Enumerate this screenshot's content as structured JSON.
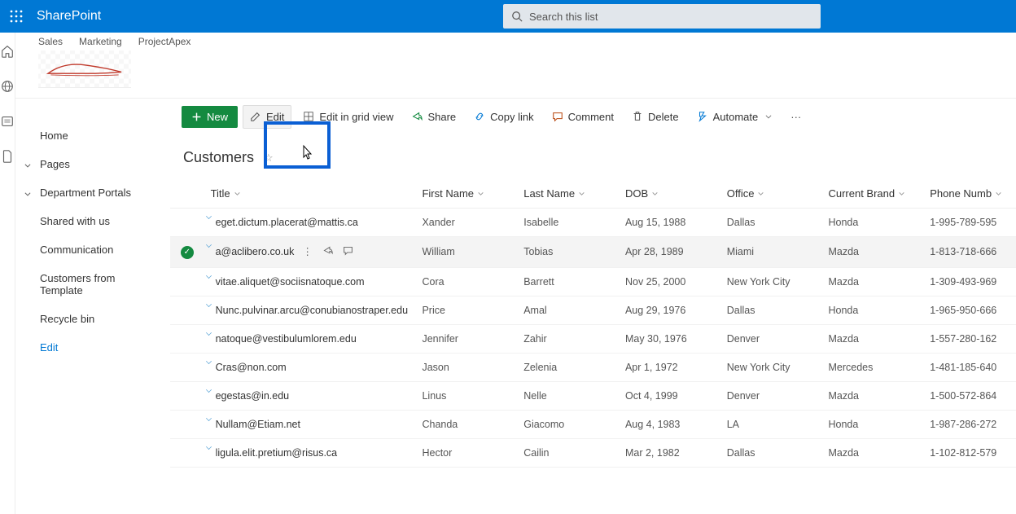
{
  "suite": {
    "appName": "SharePoint"
  },
  "search": {
    "placeholder": "Search this list"
  },
  "hub": {
    "links": [
      "Sales",
      "Marketing",
      "ProjectApex"
    ]
  },
  "nav": {
    "items": [
      {
        "label": "Home",
        "chev": false
      },
      {
        "label": "Pages",
        "chev": true
      },
      {
        "label": "Department Portals",
        "chev": true
      },
      {
        "label": "Shared with us",
        "chev": false
      },
      {
        "label": "Communication",
        "chev": false
      },
      {
        "label": "Customers from Template",
        "chev": false
      },
      {
        "label": "Recycle bin",
        "chev": false
      }
    ],
    "edit": "Edit"
  },
  "commands": {
    "new": "New",
    "edit": "Edit",
    "editGrid": "Edit in grid view",
    "share": "Share",
    "copy": "Copy link",
    "comment": "Comment",
    "delete": "Delete",
    "automate": "Automate"
  },
  "list": {
    "title": "Customers",
    "columns": [
      "Title",
      "First Name",
      "Last Name",
      "DOB",
      "Office",
      "Current Brand",
      "Phone Numb"
    ],
    "rows": [
      {
        "sel": false,
        "title": "eget.dictum.placerat@mattis.ca",
        "first": "Xander",
        "last": "Isabelle",
        "dob": "Aug 15, 1988",
        "office": "Dallas",
        "brand": "Honda",
        "phone": "1-995-789-595"
      },
      {
        "sel": true,
        "title": "a@aclibero.co.uk",
        "first": "William",
        "last": "Tobias",
        "dob": "Apr 28, 1989",
        "office": "Miami",
        "brand": "Mazda",
        "phone": "1-813-718-666"
      },
      {
        "sel": false,
        "title": "vitae.aliquet@sociisnatoque.com",
        "first": "Cora",
        "last": "Barrett",
        "dob": "Nov 25, 2000",
        "office": "New York City",
        "brand": "Mazda",
        "phone": "1-309-493-969"
      },
      {
        "sel": false,
        "title": "Nunc.pulvinar.arcu@conubianostraper.edu",
        "first": "Price",
        "last": "Amal",
        "dob": "Aug 29, 1976",
        "office": "Dallas",
        "brand": "Honda",
        "phone": "1-965-950-666"
      },
      {
        "sel": false,
        "title": "natoque@vestibulumlorem.edu",
        "first": "Jennifer",
        "last": "Zahir",
        "dob": "May 30, 1976",
        "office": "Denver",
        "brand": "Mazda",
        "phone": "1-557-280-162"
      },
      {
        "sel": false,
        "title": "Cras@non.com",
        "first": "Jason",
        "last": "Zelenia",
        "dob": "Apr 1, 1972",
        "office": "New York City",
        "brand": "Mercedes",
        "phone": "1-481-185-640"
      },
      {
        "sel": false,
        "title": "egestas@in.edu",
        "first": "Linus",
        "last": "Nelle",
        "dob": "Oct 4, 1999",
        "office": "Denver",
        "brand": "Mazda",
        "phone": "1-500-572-864"
      },
      {
        "sel": false,
        "title": "Nullam@Etiam.net",
        "first": "Chanda",
        "last": "Giacomo",
        "dob": "Aug 4, 1983",
        "office": "LA",
        "brand": "Honda",
        "phone": "1-987-286-272"
      },
      {
        "sel": false,
        "title": "ligula.elit.pretium@risus.ca",
        "first": "Hector",
        "last": "Cailin",
        "dob": "Mar 2, 1982",
        "office": "Dallas",
        "brand": "Mazda",
        "phone": "1-102-812-579"
      }
    ]
  }
}
